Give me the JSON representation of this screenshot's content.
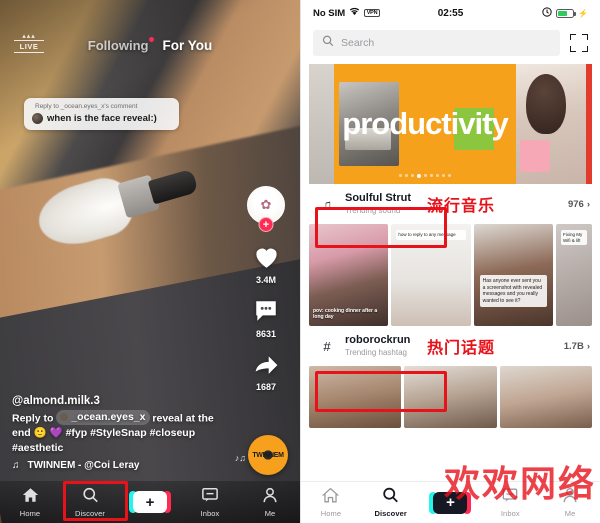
{
  "colors": {
    "accent_red": "#e8121b",
    "tiktok_pink": "#fe2c55",
    "tiktok_cyan": "#25f4ee",
    "banner_orange": "#f5a11c",
    "battery_green": "#2ecc5a"
  },
  "left_phone": {
    "live_label": "LIVE",
    "tabs": [
      {
        "label": "Following",
        "active": false,
        "has_dot": true
      },
      {
        "label": "For You",
        "active": true,
        "has_dot": false
      }
    ],
    "reply_card": {
      "header": "Reply to _ocean.eyes_x's comment",
      "text": "when is the face reveal:)"
    },
    "rail": {
      "avatar_plus": "+",
      "like_count": "3.4M",
      "comment_count": "8631",
      "share_count": "1687"
    },
    "caption": {
      "username": "@almond.milk.3",
      "reply_prefix": "Reply to",
      "reply_user": "_ocean.eyes_x",
      "body": "reveal at the end 🙂 💜 #fyp #StyleSnap #closeup #aesthetic",
      "music": "TWINNEM - @Coi Leray",
      "disc_label": "TWINNEM"
    },
    "navbar": [
      {
        "label": "Home",
        "icon": "home-icon",
        "active": false
      },
      {
        "label": "Discover",
        "icon": "search-icon",
        "active": false
      },
      {
        "label": "",
        "icon": "create-icon",
        "active": false
      },
      {
        "label": "Inbox",
        "icon": "inbox-icon",
        "active": false
      },
      {
        "label": "Me",
        "icon": "profile-icon",
        "active": false
      }
    ]
  },
  "right_phone": {
    "status_bar": {
      "carrier": "No SIM",
      "wifi": "wifi-icon",
      "vpn": "VPN",
      "time": "02:55",
      "alarm": "alarm-icon",
      "battery": "battery-icon"
    },
    "search": {
      "placeholder": "Search",
      "icon": "search-icon",
      "scan_icon": "scan-icon"
    },
    "banner": {
      "word": "productivity",
      "dots_total": 9,
      "dots_active_index": 3
    },
    "trending_sound": {
      "icon": "music-note-icon",
      "title": "Soulful Strut",
      "subtitle": "Trending sound",
      "annotation_zh": "流行音乐",
      "count": "976",
      "chevron": "›"
    },
    "trending_hashtag": {
      "icon": "hashtag-icon",
      "title": "roborockrun",
      "subtitle": "Trending hashtag",
      "annotation_zh": "热门话题",
      "count": "1.7B",
      "chevron": "›"
    },
    "video_row_1": [
      {
        "caption": "pov: cooking dinner after a long day"
      },
      {
        "caption": "how to reply to any message"
      },
      {
        "note": "Has anyone ever sent you a screenshot with revealed messages and you really wanted to see it?"
      },
      {
        "caption": "Fixing My Wifi & lift"
      }
    ],
    "video_row_2": [
      {
        "caption": ""
      },
      {
        "caption": ""
      },
      {
        "caption": ""
      }
    ],
    "navbar": [
      {
        "label": "Home",
        "icon": "home-icon",
        "active": false
      },
      {
        "label": "Discover",
        "icon": "search-icon",
        "active": true
      },
      {
        "label": "",
        "icon": "create-icon",
        "active": false
      },
      {
        "label": "Inbox",
        "icon": "inbox-icon",
        "active": false
      },
      {
        "label": "Me",
        "icon": "profile-icon",
        "active": false
      }
    ]
  },
  "watermark": {
    "text": "欢欢网络"
  }
}
